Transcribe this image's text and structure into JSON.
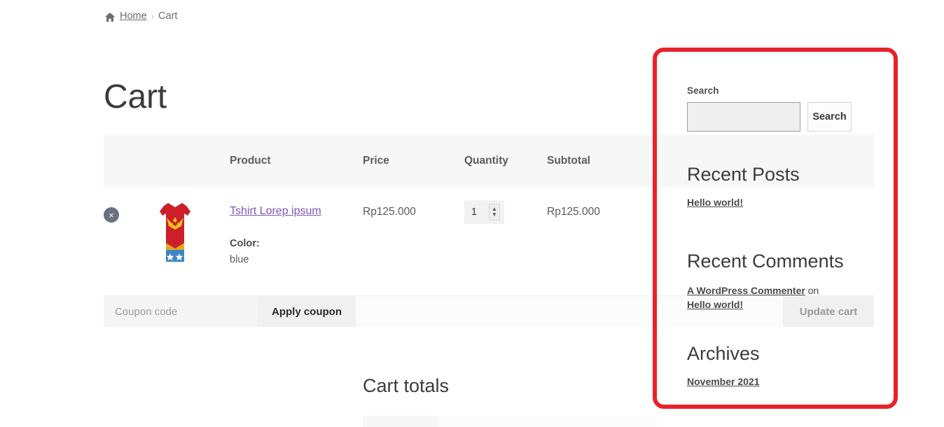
{
  "breadcrumb": {
    "home_icon": "home-icon",
    "home": "Home",
    "separator": "›",
    "current": "Cart"
  },
  "page": {
    "title": "Cart"
  },
  "cart_table": {
    "headers": {
      "remove": "",
      "thumbnail": "",
      "product": "Product",
      "price": "Price",
      "quantity": "Quantity",
      "subtotal": "Subtotal"
    },
    "rows": [
      {
        "remove_icon": "remove-item-icon",
        "remove_label": "×",
        "thumbnail_alt": "Wonder Woman t-shirt",
        "name": "Tshirt Lorep ipsum",
        "variation_label": "Color:",
        "variation_value": "blue",
        "price": "Rp125.000",
        "quantity": "1",
        "subtotal": "Rp125.000"
      }
    ],
    "coupon": {
      "placeholder": "Coupon code",
      "value": "",
      "apply_label": "Apply coupon",
      "update_label": "Update cart"
    }
  },
  "cart_totals": {
    "title": "Cart totals"
  },
  "sidebar": {
    "search": {
      "label": "Search",
      "input_value": "",
      "button_label": "Search"
    },
    "recent_posts": {
      "title": "Recent Posts",
      "items": [
        {
          "label": "Hello world!"
        }
      ]
    },
    "recent_comments": {
      "title": "Recent Comments",
      "items": [
        {
          "author": "A WordPress Commenter",
          "connector": "on",
          "post": "Hello world!"
        }
      ]
    },
    "archives": {
      "title": "Archives",
      "items": [
        {
          "label": "November 2021"
        }
      ]
    }
  },
  "annotation": {
    "color": "#e8222a",
    "target": "sidebar"
  },
  "colors": {
    "link_purple": "#7f54b3",
    "annotation_red": "#e8222a",
    "table_header_bg": "#f7f7f7",
    "text": "#43454b"
  }
}
